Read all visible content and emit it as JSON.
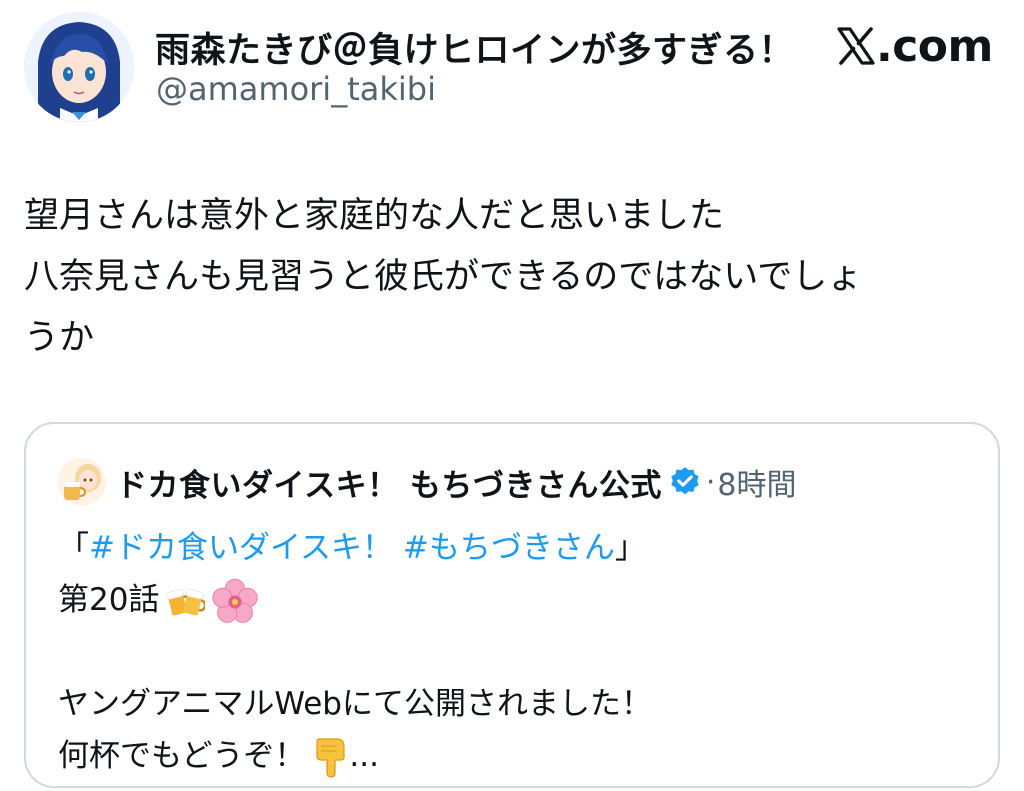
{
  "author": {
    "display_name": "雨森たきび＠負けヒロインが多すぎる！",
    "handle": "@amamori_takibi",
    "avatar_icon": "anime-girl-avatar-icon"
  },
  "brand": {
    "label": ".com",
    "icon": "x-logo-icon"
  },
  "tweet": {
    "lines": [
      "望月さんは意外と家庭的な人だと思いました",
      "八奈見さんも見習うと彼氏ができるのではないでしょ",
      "うか"
    ]
  },
  "quote": {
    "author_name": "ドカ食いダイスキ！ もちづきさん公式",
    "verified_icon": "verified-badge-icon",
    "separator": "·",
    "time": "8時間",
    "bracket_open": "「",
    "hashtag_1": "#ドカ食いダイスキ！",
    "hashtag_2": "#もちづきさん",
    "bracket_close": "」",
    "episode": "第20話",
    "emoji_beer": "beer-mugs-emoji",
    "emoji_flower": "cherry-blossom-emoji",
    "line_4": "ヤングアニマルWebにて公開されました！",
    "line_5": "何杯でもどうぞ！",
    "emoji_point": "pointing-down-emoji",
    "ellipsis": "..."
  },
  "colors": {
    "text": "#0f1419",
    "secondary": "#536471",
    "link": "#1d9bf0",
    "border": "#cfd9de"
  }
}
